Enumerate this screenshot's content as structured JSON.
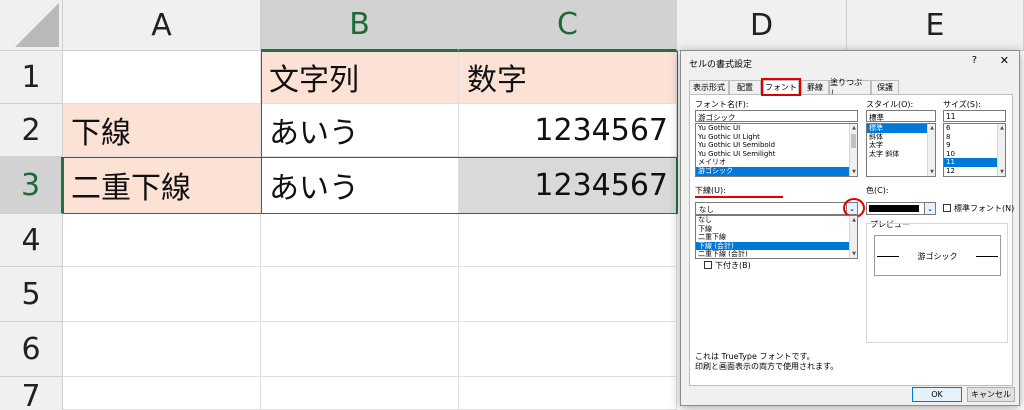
{
  "sheet": {
    "columns": [
      "A",
      "B",
      "C",
      "D",
      "E"
    ],
    "rows": [
      "1",
      "2",
      "3",
      "4",
      "5",
      "6",
      "7"
    ],
    "cells": {
      "b1": "文字列",
      "c1": "数字",
      "a2": "下線",
      "b2": "あいう",
      "c2": "1234567",
      "a3": "二重下線",
      "b3": "あいう",
      "c3": "1234567"
    },
    "colors": {
      "header_pink": "#fbe2d5",
      "selection_green": "#217346",
      "selected_cell_grey": "#d9d9d9"
    }
  },
  "dialog": {
    "title": "セルの書式設定",
    "help_label": "?",
    "close_icon": "close-icon",
    "tabs": [
      "表示形式",
      "配置",
      "フォント",
      "罫線",
      "塗りつぶし",
      "保護"
    ],
    "active_tab": "フォント",
    "font_label": "フォント名(F):",
    "font_value": "游ゴシック",
    "font_list": [
      "Yu Gothic UI",
      "Yu Gothic UI Light",
      "Yu Gothic UI Semibold",
      "Yu Gothic UI Semilight",
      "メイリオ",
      "游ゴシック"
    ],
    "font_selected_index": 5,
    "style_label": "スタイル(O):",
    "style_value": "標準",
    "style_list": [
      "標準",
      "斜体",
      "太字",
      "太字 斜体"
    ],
    "style_selected_index": 0,
    "size_label": "サイズ(S):",
    "size_value": "11",
    "size_list": [
      "6",
      "8",
      "9",
      "10",
      "11",
      "12"
    ],
    "size_selected_index": 4,
    "underline_label": "下線(U):",
    "underline_value": "なし",
    "underline_options": [
      "なし",
      "下線",
      "二重下線",
      "下線 (会計)",
      "二重下線 (会計)"
    ],
    "underline_selected_index": 3,
    "color_label": "色(C):",
    "normal_font_label": "標準フォント(N)",
    "subscript_label": "下付き(B)",
    "preview_label": "プレビュー",
    "preview_text": "游ゴシック",
    "info_line1": "これは TrueType フォントです。",
    "info_line2": "印刷と画面表示の両方で使用されます。",
    "ok_label": "OK",
    "cancel_label": "キャンセル"
  }
}
